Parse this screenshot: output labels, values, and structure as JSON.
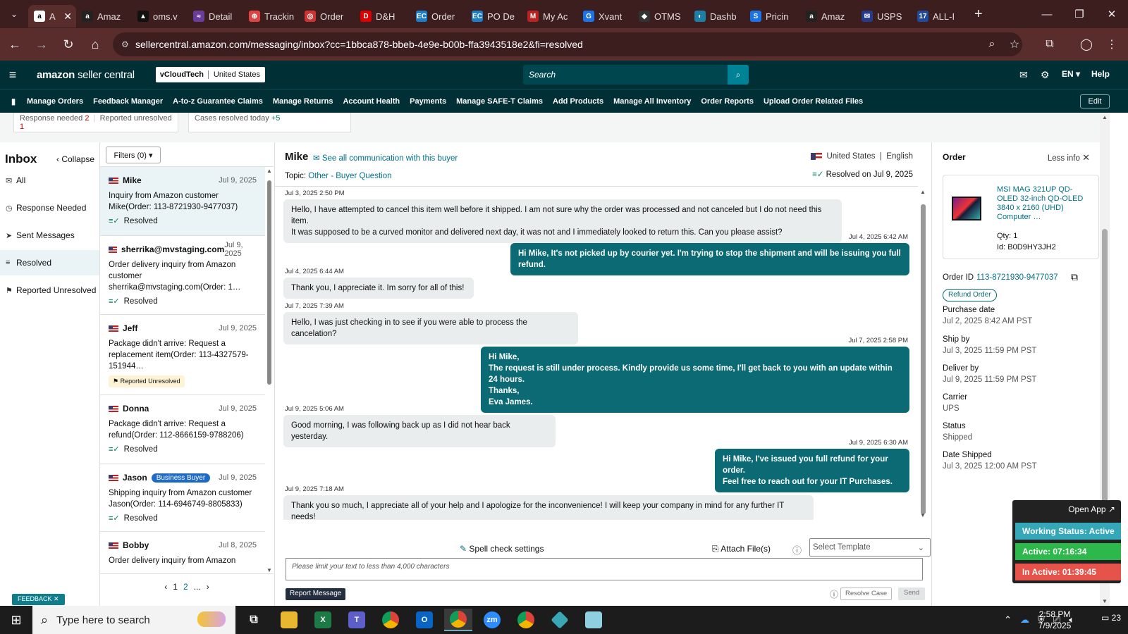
{
  "browser": {
    "tabs": [
      {
        "label": "A",
        "icon": "a"
      },
      {
        "label": "Amaz",
        "icon": "a"
      },
      {
        "label": "oms.v",
        "icon": "▲"
      },
      {
        "label": "Detail",
        "icon": "≈"
      },
      {
        "label": "Trackin",
        "icon": "⊕"
      },
      {
        "label": "Order",
        "icon": "◎"
      },
      {
        "label": "D&H",
        "icon": "D"
      },
      {
        "label": "Order",
        "icon": "EC"
      },
      {
        "label": "PO De",
        "icon": "EC"
      },
      {
        "label": "My Ac",
        "icon": "M"
      },
      {
        "label": "Xvant",
        "icon": "G"
      },
      {
        "label": "OTMS",
        "icon": "◆"
      },
      {
        "label": "Dashb",
        "icon": "◐"
      },
      {
        "label": "Pricin",
        "icon": "S"
      },
      {
        "label": "Amaz",
        "icon": "a"
      },
      {
        "label": "USPS",
        "icon": "✉"
      },
      {
        "label": "ALL-I",
        "icon": "17"
      }
    ],
    "url": "sellercentral.amazon.com/messaging/inbox?cc=1bbca878-bbeb-4e9e-b00b-ffa3943518e2&fi=resolved"
  },
  "header": {
    "logo_main": "amazon",
    "logo_sub": "seller central",
    "account": "vCloudTech",
    "marketplace": "United States",
    "search_placeholder": "Search",
    "lang": "EN ▾",
    "help": "Help"
  },
  "nav": {
    "links": [
      "Manage Orders",
      "Feedback Manager",
      "A-to-z Guarantee Claims",
      "Manage Returns",
      "Account Health",
      "Payments",
      "Manage SAFE-T Claims",
      "Add Products",
      "Manage All Inventory",
      "Order Reports",
      "Upload Order Related Files"
    ],
    "edit": "Edit"
  },
  "summary": {
    "response_needed_label": "Response needed",
    "response_needed_count": "2",
    "reported_unresolved_label": "Reported unresolved",
    "reported_unresolved_count": "1",
    "cases_resolved_label": "Cases resolved today",
    "cases_resolved_count": "+5"
  },
  "inbox": {
    "title": "Inbox",
    "collapse": "Collapse",
    "items": [
      {
        "label": "All",
        "icon": "✉"
      },
      {
        "label": "Response Needed",
        "icon": "◷"
      },
      {
        "label": "Sent Messages",
        "icon": "➤"
      },
      {
        "label": "Resolved",
        "icon": "≡"
      },
      {
        "label": "Reported Unresolved",
        "icon": "⚑"
      }
    ],
    "feedback": "FEEDBACK ✕"
  },
  "conversations": {
    "filters": "Filters (0) ▾",
    "list": [
      {
        "name": "Mike",
        "date": "Jul 9, 2025",
        "preview": "Inquiry from Amazon customer Mike(Order: 113-8721930-9477037)",
        "status": "Resolved"
      },
      {
        "name": "sherrika@mvstaging.com",
        "date": "Jul 9, 2025",
        "preview": "Order delivery inquiry from Amazon customer sherrika@mvstaging.com(Order: 1…",
        "status": "Resolved"
      },
      {
        "name": "Jeff",
        "date": "Jul 9, 2025",
        "preview": "Package didn't arrive: Request a replacement item(Order: 113-4327579-151944…",
        "status": "Reported Unresolved"
      },
      {
        "name": "Donna",
        "date": "Jul 9, 2025",
        "preview": "Package didn't arrive: Request a refund(Order: 112-8666159-9788206)",
        "status": "Resolved"
      },
      {
        "name": "Jason",
        "badge": "Business Buyer",
        "date": "Jul 9, 2025",
        "preview": "Shipping inquiry from Amazon customer Jason(Order: 114-6946749-8805833)",
        "status": "Resolved"
      },
      {
        "name": "Bobby",
        "date": "Jul 8, 2025",
        "preview": "Order delivery inquiry from Amazon",
        "status": ""
      }
    ],
    "pager": {
      "prev": "‹",
      "p1": "1",
      "p2": "2",
      "more": "...",
      "next": "›"
    }
  },
  "thread": {
    "buyer": "Mike",
    "see_all": "See all communication with this buyer",
    "topic_label": "Topic:",
    "topic": "Other - Buyer Question",
    "region": "United States",
    "language": "English",
    "resolved_on": "Resolved on Jul 9, 2025",
    "messages": [
      {
        "dir": "in",
        "time": "Jul 3, 2025 2:50 PM",
        "text": "Hello, I have attempted to cancel this item well before it shipped. I am not sure why the order was processed and not canceled but I do not need this item.\nIt was supposed to be a curved monitor and delivered next day, it was not and I immediately looked to return this. Can you please assist?"
      },
      {
        "dir": "out",
        "time": "Jul 4, 2025 6:42 AM",
        "text": "Hi Mike, It's not picked up by courier yet. I'm trying to stop the shipment and will be issuing you full refund."
      },
      {
        "dir": "in",
        "time": "Jul 4, 2025 6:44 AM",
        "text": "Thank you, I appreciate it. Im sorry for all of this!"
      },
      {
        "dir": "in",
        "time": "Jul 7, 2025 7:39 AM",
        "text": "Hello, I was just checking in to see if you were able to process the cancelation?"
      },
      {
        "dir": "out",
        "time": "Jul 7, 2025 2:58 PM",
        "text": "Hi Mike,\nThe request is still under process. Kindly provide us some time, I'll get back to you with an update within  24 hours.\nThanks,\nEva James."
      },
      {
        "dir": "in",
        "time": "Jul 9, 2025 5:06 AM",
        "text": "Good morning, I was following back up as I did not hear back yesterday."
      },
      {
        "dir": "out",
        "time": "Jul 9, 2025 6:30 AM",
        "text": "Hi Mike, I've issued you full refund for your order.\nFeel free to reach out for your IT Purchases."
      },
      {
        "dir": "in",
        "time": "Jul 9, 2025 7:18 AM",
        "text": "Thank you so much, I appreciate all of your help and I apologize for the inconvenience! I will keep your company in mind for any further IT needs!"
      }
    ],
    "spell": "Spell check settings",
    "attach": "Attach File(s)",
    "template_placeholder": "Select Template",
    "input_placeholder": "Please limit your text to less than 4,000 characters",
    "report": "Report Message",
    "resolve": "Resolve Case",
    "send": "Send"
  },
  "order": {
    "title": "Order",
    "less_info": "Less info",
    "product": "MSI MAG 321UP QD-OLED 32-inch QD-OLED 3840 x 2160 (UHD) Computer …",
    "qty_label": "Qty:",
    "qty": "1",
    "id_label": "Id:",
    "id": "B0D9HY3JH2",
    "order_id_label": "Order ID",
    "order_id": "113-8721930-9477037",
    "refund": "Refund Order",
    "fields": [
      {
        "label": "Purchase date",
        "value": "Jul 2, 2025 8:42 AM PST"
      },
      {
        "label": "Ship by",
        "value": "Jul 3, 2025 11:59 PM PST"
      },
      {
        "label": "Deliver by",
        "value": "Jul 9, 2025 11:59 PM PST"
      },
      {
        "label": "Carrier",
        "value": "UPS"
      },
      {
        "label": "Status",
        "value": "Shipped"
      },
      {
        "label": "Date Shipped",
        "value": "Jul 3, 2025 12:00 AM PST"
      }
    ]
  },
  "widget": {
    "open": "Open App ↗",
    "working": "Working Status: Active",
    "active": "Active: 07:16:34",
    "inactive": "In Active: 01:39:45"
  },
  "taskbar": {
    "search": "Type here to search",
    "time": "2:58 PM",
    "date": "7/9/2025",
    "notifications": "23"
  },
  "colors": {
    "header": "#002f36",
    "accent": "#007185",
    "outgoing": "#0b6a73",
    "active_green": "#2db84b",
    "inactive_red": "#e5534b",
    "working_teal": "#34a8b8"
  }
}
